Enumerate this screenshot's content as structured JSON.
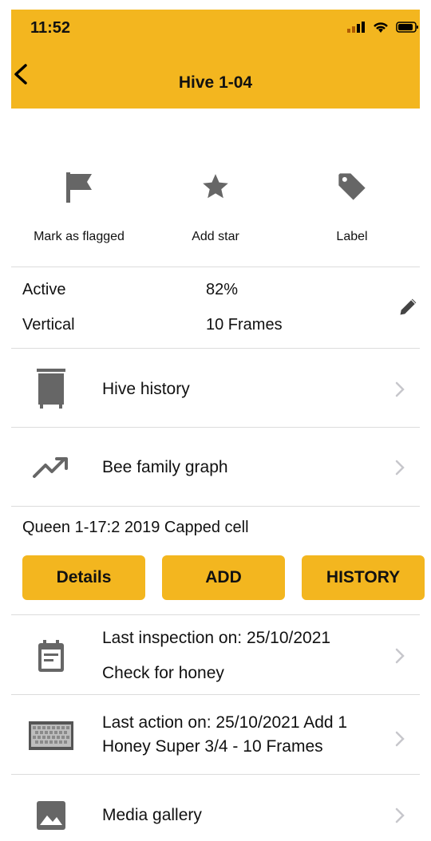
{
  "status": {
    "time": "11:52"
  },
  "header": {
    "title": "Hive 1-04"
  },
  "quick_actions": {
    "flag_label": "Mark as flagged",
    "star_label": "Add star",
    "label_label": "Label"
  },
  "info": {
    "status": "Active",
    "strength": "82%",
    "type": "Vertical",
    "frames": "10 Frames"
  },
  "rows": {
    "hive_history": "Hive history",
    "bee_family_graph": "Bee family graph",
    "last_inspection_line1": "Last inspection on: 25/10/2021",
    "last_inspection_line2": "Check for honey",
    "last_action_line1": "Last action on: 25/10/2021 Add 1",
    "last_action_line2": "Honey Super 3/4 - 10 Frames",
    "media_gallery": "Media gallery"
  },
  "queen": {
    "text": "Queen 1-17:2 2019 Capped cell",
    "details_label": "Details",
    "add_label": "ADD",
    "history_label": "HISTORY"
  },
  "colors": {
    "accent": "#f3b61f",
    "icon_gray": "#666666",
    "chevron": "#c7c7cc"
  }
}
